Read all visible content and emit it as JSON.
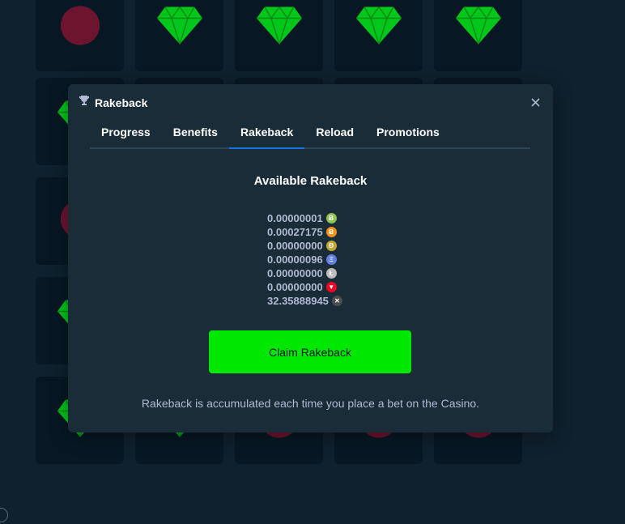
{
  "modal": {
    "title": "Rakeback",
    "header_icon": "trophy-icon",
    "close_icon": "close-icon",
    "tabs": [
      {
        "label": "Progress"
      },
      {
        "label": "Benefits"
      },
      {
        "label": "Rakeback",
        "active": true
      },
      {
        "label": "Reload"
      },
      {
        "label": "Promotions"
      }
    ],
    "section_title": "Available Rakeback",
    "amounts": [
      {
        "value": "0.00000001",
        "icon": "bitcoin-cash-icon",
        "color": "#8dc351",
        "glyph": "Ƀ"
      },
      {
        "value": "0.00027175",
        "icon": "bitcoin-icon",
        "color": "#f7931a",
        "glyph": "Ƀ"
      },
      {
        "value": "0.00000000",
        "icon": "dogecoin-icon",
        "color": "#c2a633",
        "glyph": "Ð"
      },
      {
        "value": "0.00000096",
        "icon": "ethereum-icon",
        "color": "#627eea",
        "glyph": "Ξ"
      },
      {
        "value": "0.00000000",
        "icon": "litecoin-icon",
        "color": "#bfbbbb",
        "glyph": "Ł"
      },
      {
        "value": "0.00000000",
        "icon": "tron-icon",
        "color": "#ec0623",
        "glyph": "▼"
      },
      {
        "value": "32.35888945",
        "icon": "ripple-icon",
        "color": "#4d4d4d",
        "glyph": "✕"
      }
    ],
    "claim_label": "Claim Rakeback",
    "footer_note": "Rakeback is accumulated each time you place a bet on the Casino."
  },
  "colors": {
    "page_bg": "#0f212e",
    "tile_bg": "#071824",
    "modal_bg": "#1a2c38",
    "accent_tab": "#1475e1",
    "claim_green": "#00e701",
    "muted_text": "#b1bad3",
    "gem_green": "#00c71a",
    "mine_red": "#e9113c"
  },
  "background_board": {
    "tiles": [
      [
        "mine-icon",
        "gem-icon",
        "gem-icon",
        "gem-icon",
        "gem-icon"
      ],
      [
        "gem-icon",
        "gem-icon",
        "gem-icon",
        "gem-icon",
        "gem-icon"
      ],
      [
        "mine-icon",
        "gem-icon",
        "gem-icon",
        "gem-icon",
        "gem-icon"
      ],
      [
        "gem-icon",
        "gem-icon",
        "gem-icon",
        "gem-icon",
        "gem-icon"
      ],
      [
        "gem-icon",
        "gem-icon",
        "mine-icon",
        "mine-icon",
        "mine-icon"
      ]
    ]
  }
}
